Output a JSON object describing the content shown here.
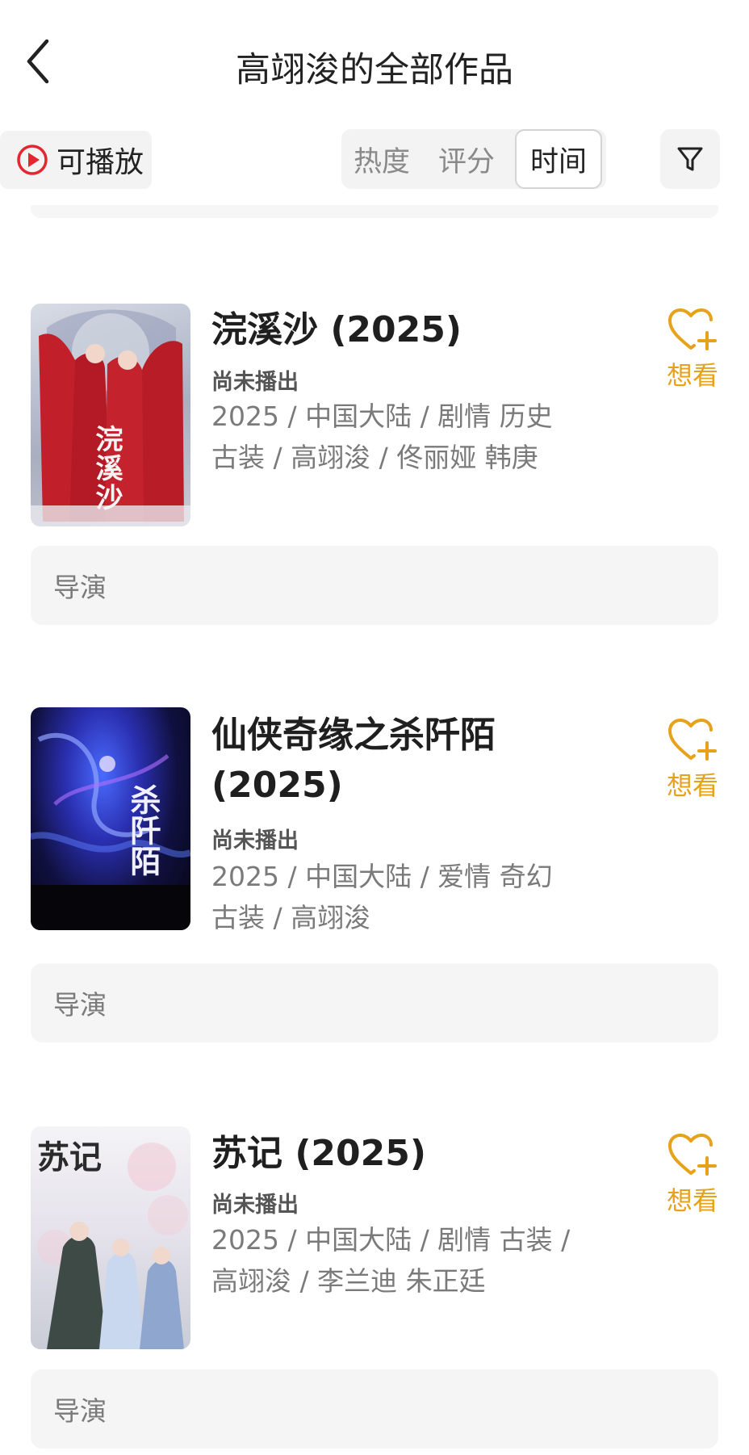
{
  "header": {
    "title": "高翊浚的全部作品"
  },
  "filter_bar": {
    "playable_label": "可播放",
    "sort_tabs": [
      {
        "label": "热度",
        "active": false
      },
      {
        "label": "评分",
        "active": false
      },
      {
        "label": "时间",
        "active": true
      }
    ]
  },
  "works": [
    {
      "title": "浣溪沙 (2025)",
      "status": "尚未播出",
      "meta_line1": "2025 / 中国大陆 / 剧情 历史",
      "meta_line2": "古装 / 高翊浚 / 佟丽娅 韩庚",
      "want_label": "想看",
      "director_label": "导演",
      "poster_text": "浣溪沙"
    },
    {
      "title": "仙侠奇缘之杀阡陌 (2025)",
      "status": "尚未播出",
      "meta_line1": "2025 / 中国大陆 / 爱情 奇幻",
      "meta_line2": "古装 / 高翊浚",
      "want_label": "想看",
      "director_label": "导演",
      "poster_text": "杀阡陌"
    },
    {
      "title": "苏记 (2025)",
      "status": "尚未播出",
      "meta_line1": "2025 / 中国大陆 / 剧情 古装 /",
      "meta_line2": "高翊浚 / 李兰迪 朱正廷",
      "want_label": "想看",
      "director_label": "导演",
      "poster_text": "苏记"
    }
  ],
  "colors": {
    "accent": "#e7a21b",
    "play_red": "#e3262f",
    "text_primary": "#1f1f1f",
    "text_secondary": "#7a7a7a"
  }
}
